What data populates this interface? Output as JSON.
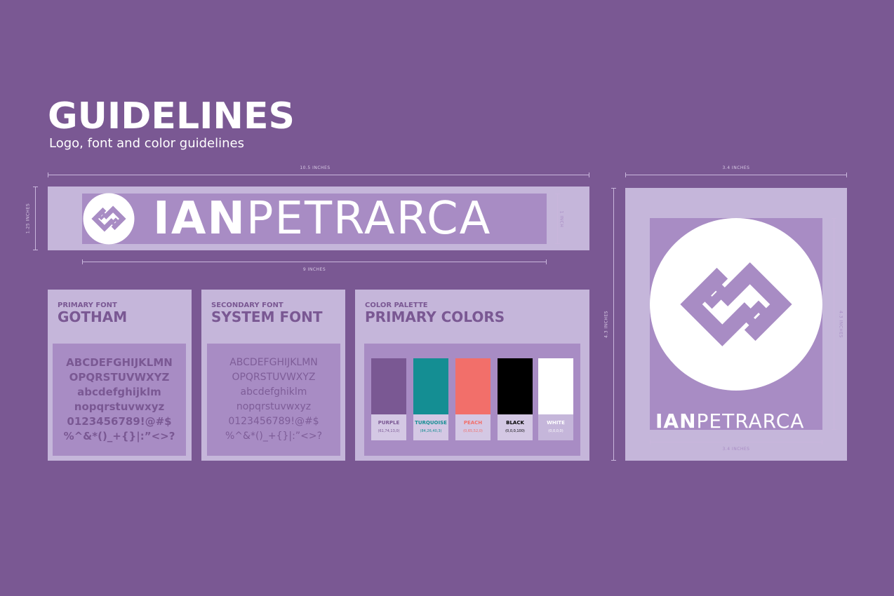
{
  "header": {
    "title": "GUIDELINES",
    "subtitle": "Logo, font and color guidelines"
  },
  "logo": {
    "word_bold": "IAN",
    "word_light": "PETRARCA",
    "icon": "interlocking-link-icon"
  },
  "dimensions": {
    "banner_width": "10.5 INCHES",
    "banner_height": "1.25 INCHES",
    "logo_width": "9 INCHES",
    "logo_height": "1 INCH",
    "square_width_top": "3.4 INCHES",
    "square_height": "4.3 INCHES",
    "square_inner_height": "4.3 INCHES",
    "square_inner_width": "3.4 INCHES"
  },
  "fonts": {
    "primary": {
      "label": "PRIMARY FONT",
      "name": "GOTHAM",
      "lines": [
        "ABCDEFGHIJKLMN",
        "OPQRSTUVWXYZ",
        "abcdefghijklm",
        "nopqrstuvwxyz",
        "0123456789!@#$",
        "%^&*()_+{}|:”<>?"
      ]
    },
    "secondary": {
      "label": "SECONDARY FONT",
      "name": "SYSTEM FONT",
      "lines": [
        "ABCDEFGHIJKLMN",
        "OPQRSTUVWXYZ",
        "abcdefghiklm",
        "nopqrstuvwxyz",
        "0123456789!@#$",
        "%^&*()_+{}|:”<>?"
      ]
    }
  },
  "palette": {
    "label": "COLOR PALETTE",
    "name": "PRIMARY COLORS",
    "colors": [
      {
        "name": "PURPLE",
        "code": "(61,74,13,0)",
        "hex": "#7a5893",
        "text": "#7a5893"
      },
      {
        "name": "TURQUOISE",
        "code": "(84,26,40,3)",
        "hex": "#148e93",
        "text": "#148e93"
      },
      {
        "name": "PEACH",
        "code": "(0,65,52,0)",
        "hex": "#f26f6a",
        "text": "#f26f6a"
      },
      {
        "name": "BLACK",
        "code": "(0,0,0,100)",
        "hex": "#000000",
        "text": "#000000"
      },
      {
        "name": "WHITE",
        "code": "(0,0,0,0)",
        "hex": "#ffffff",
        "text": "#ffffff"
      }
    ]
  }
}
